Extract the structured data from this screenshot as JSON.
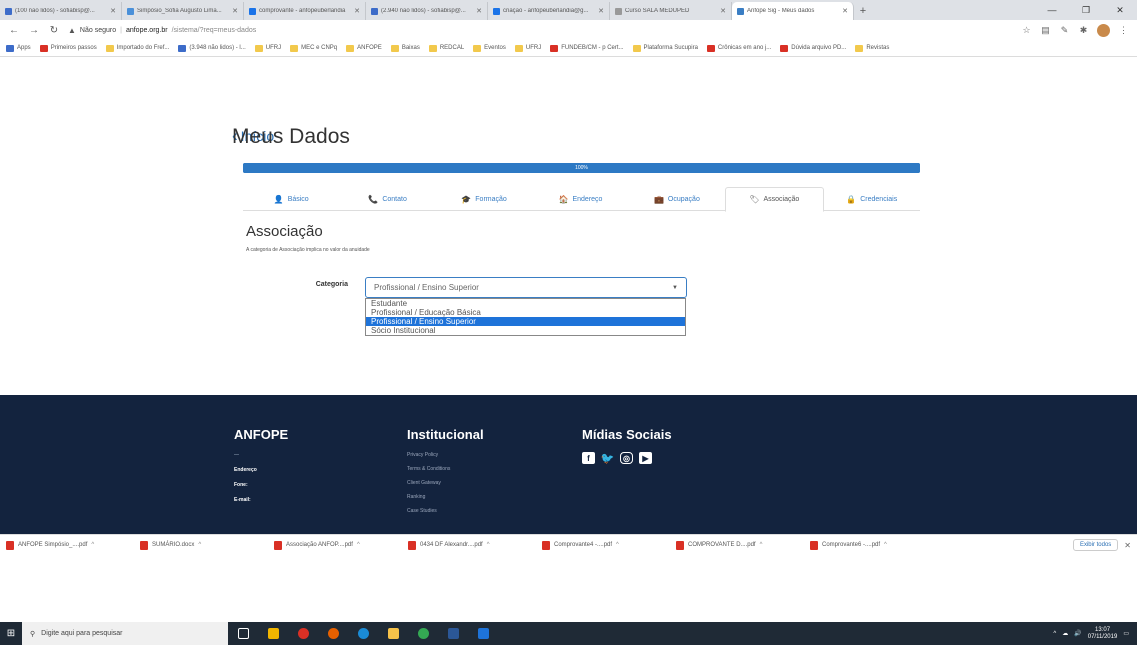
{
  "browser": {
    "tabs": [
      {
        "title": "(100 não lidos) - sofiabisp@...",
        "favicon_color": "#3d6cc9",
        "active": false
      },
      {
        "title": "Simpósio_Sofia Augusto Lima...",
        "favicon_color": "#4a90d9",
        "active": false
      },
      {
        "title": "comprovante - anfopeuberlandia",
        "favicon_color": "#1a73e8",
        "active": false
      },
      {
        "title": "(2.940 não lidos) - sofiabisp@...",
        "favicon_color": "#3d6cc9",
        "active": false
      },
      {
        "title": "criação - anfopeuberlandia@g...",
        "favicon_color": "#1a73e8",
        "active": false
      },
      {
        "title": "Curso SALA MEDUPED",
        "favicon_color": "#999999",
        "active": false
      },
      {
        "title": "Anfope Sig - Meus dados",
        "favicon_color": "#3a7ec4",
        "active": true
      }
    ],
    "new_tab": "+",
    "window_controls": [
      "—",
      "❐",
      "✕"
    ],
    "address": {
      "security": "Não seguro",
      "host": "anfope.org.br",
      "path": "/sistema/?req=meus-dados"
    },
    "bookmarks": [
      {
        "label": "Apps",
        "color": "blue"
      },
      {
        "label": "Primeiros passos",
        "color": "red"
      },
      {
        "label": "Importado do Fref...",
        "color": "yellow"
      },
      {
        "label": "(3.948 não lidos) - l...",
        "color": "blue"
      },
      {
        "label": "UFRJ",
        "color": "yellow"
      },
      {
        "label": "MEC e CNPq",
        "color": "yellow"
      },
      {
        "label": "ANFOPE",
        "color": "yellow"
      },
      {
        "label": "Baixas",
        "color": "yellow"
      },
      {
        "label": "REDCAL",
        "color": "yellow"
      },
      {
        "label": "Eventos",
        "color": "yellow"
      },
      {
        "label": "UFRJ",
        "color": "yellow"
      },
      {
        "label": "FUNDEB/CM - p Cert...",
        "color": "red"
      },
      {
        "label": "Plataforma Sucupira",
        "color": "yellow"
      },
      {
        "label": "Crônicas em ano j...",
        "color": "red"
      },
      {
        "label": "Dúvida arquivo PD...",
        "color": "red"
      },
      {
        "label": "Revistas",
        "color": "yellow"
      }
    ]
  },
  "page": {
    "back_label": "Início",
    "title": "Meus Dados",
    "progress": {
      "value": 1.0,
      "label": "100%"
    },
    "tabs": [
      {
        "label": "Básico",
        "icon": "user-icon",
        "glyph": "👤",
        "active": false
      },
      {
        "label": "Contato",
        "icon": "phone-icon",
        "glyph": "📞",
        "active": false
      },
      {
        "label": "Formação",
        "icon": "graduation-icon",
        "glyph": "🎓",
        "active": false
      },
      {
        "label": "Endereço",
        "icon": "home-icon",
        "glyph": "🏠",
        "active": false
      },
      {
        "label": "Ocupação",
        "icon": "briefcase-icon",
        "glyph": "💼",
        "active": false
      },
      {
        "label": "Associação",
        "icon": "tag-icon",
        "glyph": "🏷",
        "active": true
      },
      {
        "label": "Credenciais",
        "icon": "lock-icon",
        "glyph": "🔒",
        "active": false
      }
    ],
    "section": {
      "title": "Associação",
      "description": "A categoria de Associação implica no valor da anuidade"
    },
    "category": {
      "label": "Categoria",
      "selected": "Profissional / Ensino Superior",
      "options": [
        "Estudante",
        "Profissional / Educação Básica",
        "Profissional / Ensino Superior",
        "Sócio Institucional"
      ]
    }
  },
  "footer": {
    "anfope": {
      "title": "ANFOPE",
      "rows": [
        "—",
        "Endereço",
        "Fone:",
        "E-mail:"
      ]
    },
    "institucional": {
      "title": "Institucional",
      "links": [
        "Privacy Policy",
        "Terms & Conditions",
        "Client Gateway",
        "Ranking",
        "Case Studies"
      ]
    },
    "midias": {
      "title": "Mídias Sociais",
      "icons": [
        "facebook-icon",
        "twitter-icon",
        "instagram-icon",
        "youtube-icon"
      ]
    }
  },
  "downloads": {
    "items": [
      "ANFOPE Simpósio_....pdf",
      "SUMÁRIO.docx",
      "Associação ANFOP....pdf",
      "0434 DF Alexandr....pdf",
      "Comprovante4 -....pdf",
      "COMPROVANTE D....pdf",
      "Comprovante6 -....pdf"
    ],
    "show_all": "Exibir todos"
  },
  "taskbar": {
    "search_placeholder": "Digite aqui para pesquisar",
    "time": "13:07",
    "date": "07/11/2019"
  }
}
